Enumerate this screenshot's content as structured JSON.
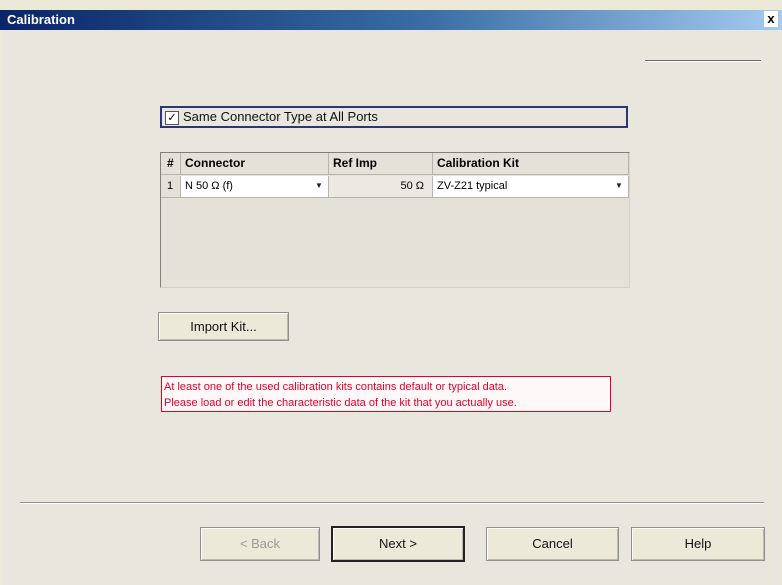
{
  "window": {
    "title": "Calibration",
    "close_label": "x"
  },
  "same_connector": {
    "label": "Same Connector Type at All Ports",
    "checked": true,
    "check_glyph": "✓"
  },
  "grid": {
    "headers": [
      "#",
      "Connector",
      "Ref Imp",
      "Calibration Kit"
    ],
    "rows": [
      {
        "index": "1",
        "connector": "N 50 Ω (f)",
        "ref_imp": "50 Ω",
        "kit": "ZV-Z21 typical"
      }
    ]
  },
  "buttons": {
    "import": "Import Kit...",
    "back": "< Back",
    "next": "Next >",
    "cancel": "Cancel",
    "help": "Help"
  },
  "warning": {
    "line1": "At least one of the used calibration kits contains default or typical data.",
    "line2": "Please load or edit the characteristic data of the kit that you actually use.",
    "color": "#e0002b"
  }
}
